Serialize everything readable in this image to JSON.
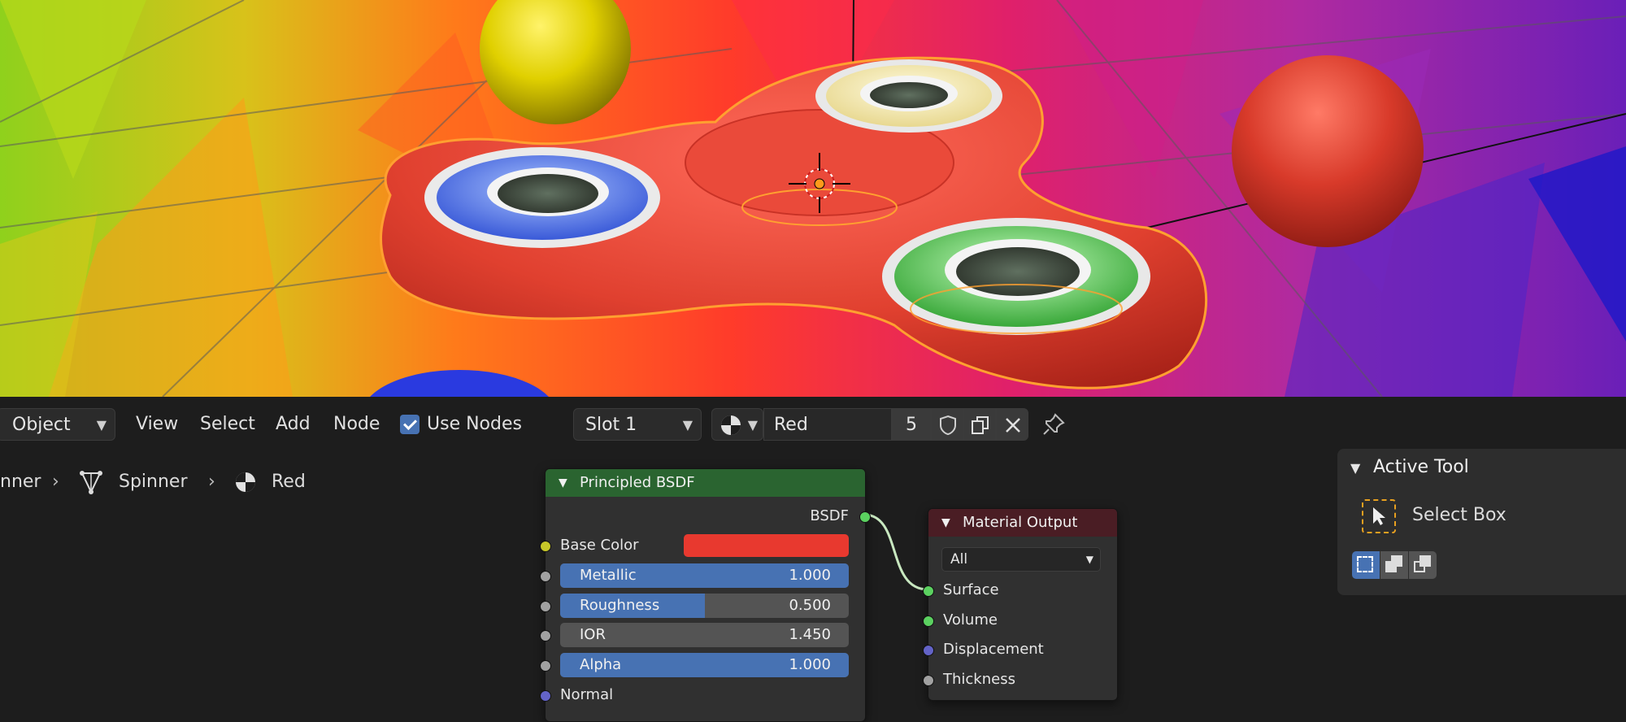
{
  "viewport": {
    "colors": {
      "orange": "#ff7a1a",
      "red_object": "#e8473a",
      "outline": "#ffa030"
    }
  },
  "header": {
    "mode_dropdown": "Object",
    "menus": [
      "View",
      "Select",
      "Add",
      "Node"
    ],
    "use_nodes_label": "Use Nodes",
    "use_nodes_checked": true,
    "slot_dropdown": "Slot 1",
    "material_name": "Red",
    "user_count": "5",
    "icons": [
      "material-sphere-icon",
      "fake-user-shield-icon",
      "duplicate-icon",
      "unlink-x-icon",
      "pin-icon"
    ]
  },
  "breadcrumb": {
    "items": [
      "nner",
      "Spinner",
      "Red"
    ]
  },
  "principled_node": {
    "title": "Principled BSDF",
    "output_label": "BSDF",
    "base_color_label": "Base Color",
    "base_color": "#e8392f",
    "fields": [
      {
        "label": "Metallic",
        "value": "1.000",
        "fraction": 1.0
      },
      {
        "label": "Roughness",
        "value": "0.500",
        "fraction": 0.5
      },
      {
        "label": "IOR",
        "value": "1.450",
        "fraction": 0.0
      },
      {
        "label": "Alpha",
        "value": "1.000",
        "fraction": 1.0
      }
    ],
    "normal_label": "Normal"
  },
  "output_node": {
    "title": "Material Output",
    "target_dropdown": "All",
    "inputs": [
      "Surface",
      "Volume",
      "Displacement",
      "Thickness"
    ]
  },
  "tool_panel": {
    "title": "Active Tool",
    "tool_name": "Select Box"
  }
}
